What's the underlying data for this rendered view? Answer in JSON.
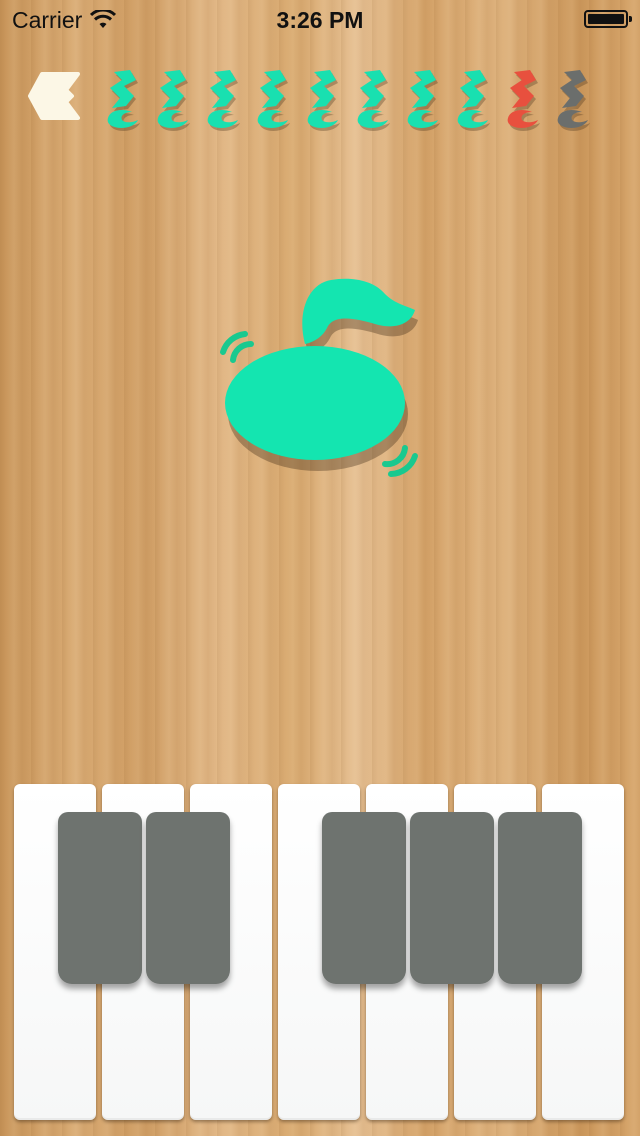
{
  "status_bar": {
    "carrier": "Carrier",
    "time": "3:26 PM"
  },
  "game": {
    "progress": {
      "total_notes": 10,
      "completed": 8,
      "current_index": 8,
      "note_states": [
        "done",
        "done",
        "done",
        "done",
        "done",
        "done",
        "done",
        "done",
        "current",
        "pending"
      ]
    },
    "target_note_color": "#14e5b0",
    "piano": {
      "white_keys": 7,
      "black_keys_after_white": [
        1,
        2,
        4,
        5,
        6
      ]
    }
  },
  "colors": {
    "done": "#19e0b0",
    "current": "#e8503e",
    "pending": "#6b6e6c",
    "black_key": "#6e736f",
    "back_button": "#fcf7e6"
  }
}
